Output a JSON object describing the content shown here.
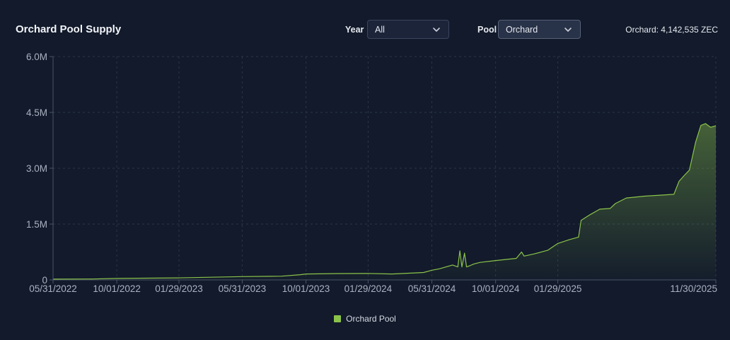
{
  "header": {
    "title": "Orchard Pool Supply",
    "summary": "Orchard: 4,142,535 ZEC"
  },
  "filters": {
    "year_label": "Year",
    "year_value": "All",
    "pool_label": "Pool",
    "pool_value": "Orchard"
  },
  "colors": {
    "background": "#121a2b",
    "line": "#8bc34a",
    "grid": "#2c3548",
    "axis_text": "#aab2c2"
  },
  "chart_data": {
    "type": "area",
    "title": "Orchard Pool Supply",
    "xlabel": "",
    "ylabel": "",
    "x_tick_labels": [
      "05/31/2022",
      "10/01/2022",
      "01/29/2023",
      "05/31/2023",
      "10/01/2023",
      "01/29/2024",
      "05/31/2024",
      "10/01/2024",
      "01/29/2025",
      "11/30/2025"
    ],
    "y_tick_labels": [
      "0",
      "1.5M",
      "3.0M",
      "4.5M",
      "6.0M"
    ],
    "y_tick_values": [
      0,
      1500000,
      3000000,
      4500000,
      6000000
    ],
    "ylim": [
      0,
      6000000
    ],
    "xlim": [
      "2022-05-31",
      "2025-11-30"
    ],
    "grid": true,
    "legend_position": "bottom",
    "series": [
      {
        "name": "Orchard Pool",
        "color": "#8bc34a",
        "x": [
          "2022-05-31",
          "2022-08-15",
          "2022-10-01",
          "2023-01-29",
          "2023-05-31",
          "2023-08-15",
          "2023-09-20",
          "2023-10-01",
          "2023-12-01",
          "2024-01-29",
          "2024-03-15",
          "2024-05-15",
          "2024-05-31",
          "2024-06-15",
          "2024-07-10",
          "2024-07-20",
          "2024-07-24",
          "2024-07-28",
          "2024-08-02",
          "2024-08-06",
          "2024-08-12",
          "2024-08-20",
          "2024-09-01",
          "2024-10-01",
          "2024-11-10",
          "2024-11-20",
          "2024-11-25",
          "2024-12-15",
          "2025-01-10",
          "2025-01-29",
          "2025-02-20",
          "2025-03-10",
          "2025-03-15",
          "2025-04-01",
          "2025-04-20",
          "2025-05-10",
          "2025-05-20",
          "2025-06-10",
          "2025-07-15",
          "2025-08-20",
          "2025-09-10",
          "2025-09-20",
          "2025-10-01",
          "2025-10-10",
          "2025-10-22",
          "2025-11-01",
          "2025-11-10",
          "2025-11-20",
          "2025-11-30"
        ],
        "values": [
          20000,
          25000,
          40000,
          55000,
          90000,
          100000,
          140000,
          160000,
          170000,
          175000,
          160000,
          200000,
          260000,
          300000,
          400000,
          350000,
          780000,
          350000,
          720000,
          350000,
          380000,
          430000,
          470000,
          520000,
          580000,
          750000,
          640000,
          700000,
          800000,
          980000,
          1080000,
          1150000,
          1600000,
          1750000,
          1900000,
          1920000,
          2050000,
          2200000,
          2250000,
          2280000,
          2300000,
          2650000,
          2820000,
          2950000,
          3700000,
          4150000,
          4200000,
          4100000,
          4142535
        ]
      }
    ]
  }
}
